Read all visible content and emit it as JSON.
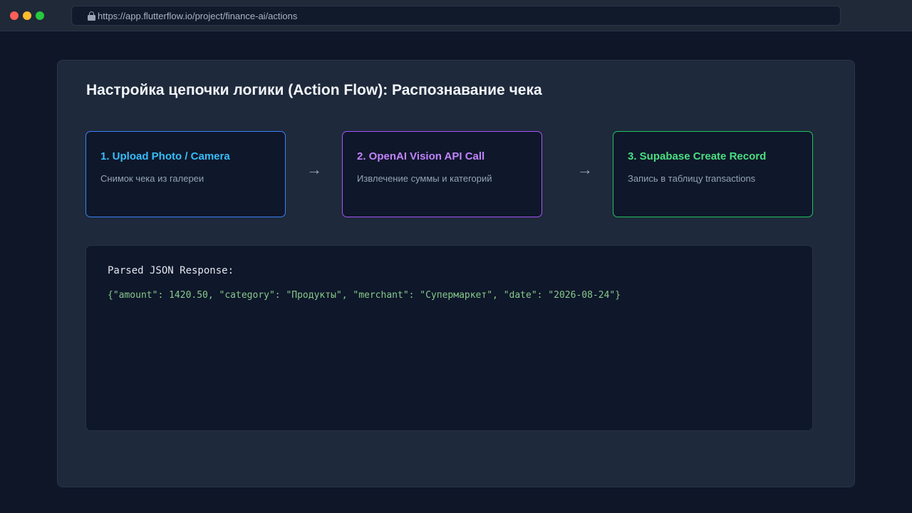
{
  "window": {
    "url": "https://app.flutterflow.io/project/finance-ai/actions"
  },
  "page": {
    "title": "Настройка цепочки логики (Action Flow): Распознавание чека"
  },
  "steps": [
    {
      "title": "1. Upload Photo / Camera",
      "description": "Снимок чека из галереи",
      "color": "#3b82f6"
    },
    {
      "title": "2. OpenAI Vision API Call",
      "description": "Извлечение суммы и категорий",
      "color": "#a855f7"
    },
    {
      "title": "3. Supabase Create Record",
      "description": "Запись в таблицу transactions",
      "color": "#22c55e"
    }
  ],
  "arrows": [
    "→",
    "→"
  ],
  "response": {
    "label": "Parsed JSON Response:",
    "body": "{\"amount\": 1420.50, \"category\": \"Продукты\", \"merchant\": \"Супермаркет\", \"date\": \"2026-08-24\"}"
  },
  "icons": {
    "url_lock": "lock-icon",
    "flow_arrow": "arrow-right-icon"
  }
}
